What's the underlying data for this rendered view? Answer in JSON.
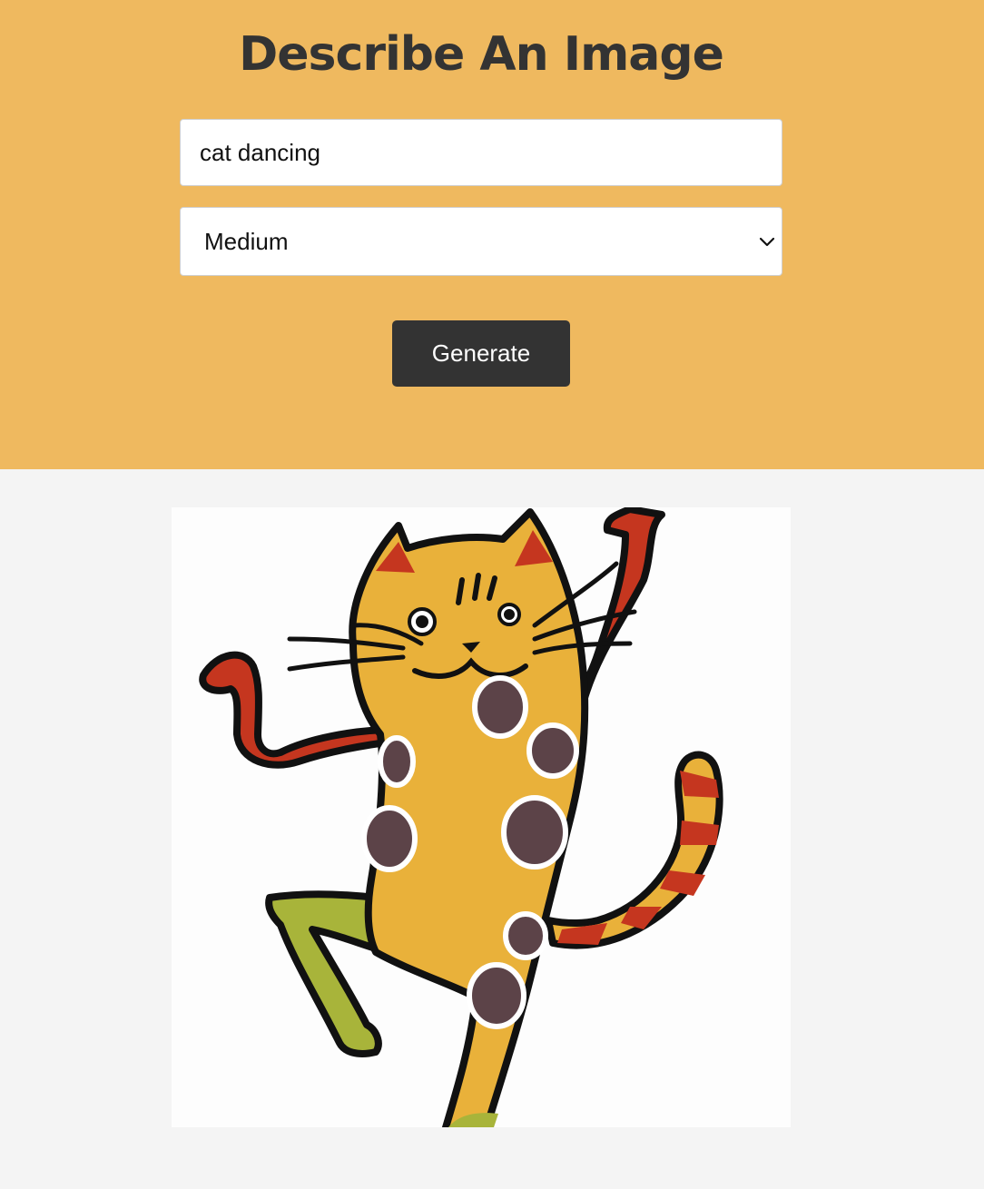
{
  "header": {
    "title": "Describe An Image"
  },
  "form": {
    "prompt_value": "cat dancing",
    "size_options": [
      "Medium"
    ],
    "size_selected": "Medium",
    "generate_label": "Generate"
  },
  "result": {
    "image_subject": "dancing-cat-illustration"
  },
  "colors": {
    "hero_bg": "#efb95f",
    "page_bg": "#f4f4f4",
    "button_bg": "#333333",
    "title_color": "#333333"
  }
}
